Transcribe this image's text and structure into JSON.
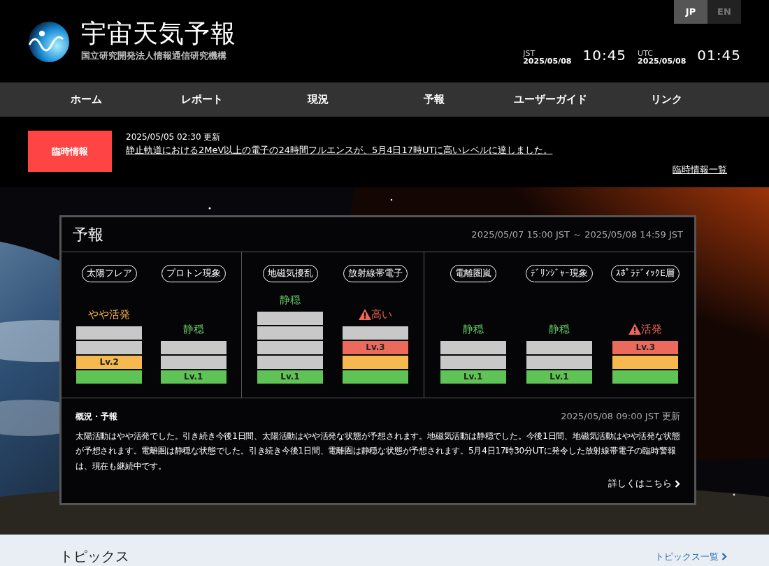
{
  "header": {
    "title": "宇宙天気予報",
    "subtitle": "国立研究開発法人情報通信研究機構",
    "languages": [
      {
        "label": "JP",
        "selected": true
      },
      {
        "label": "EN",
        "selected": false
      }
    ],
    "clocks": [
      {
        "zone": "JST",
        "date": "2025/05/08",
        "time": "10:45"
      },
      {
        "zone": "UTC",
        "date": "2025/05/08",
        "time": "01:45"
      }
    ]
  },
  "nav": [
    "ホーム",
    "レポート",
    "現況",
    "予報",
    "ユーザーガイド",
    "リンク"
  ],
  "alert": {
    "badge": "臨時情報",
    "updated": "2025/05/05 02:30 更新",
    "message": "静止軌道における2MeV以上の電子の24時間フルエンスが、5月4日17時UTに高いレベルに達しました。",
    "list_link": "臨時情報一覧"
  },
  "forecast": {
    "title": "予報",
    "period": "2025/05/07 15:00 JST ～ 2025/05/08 14:59 JST",
    "groups": [
      {
        "items": [
          {
            "name": "太陽フレア",
            "status": "やや活発",
            "kind": "active",
            "segments": [
              {
                "lit": false
              },
              {
                "lit": false
              },
              {
                "lit": true,
                "color": "#f5b94f",
                "label": "Lv.2"
              },
              {
                "lit": true,
                "color": "#5fc455"
              }
            ]
          },
          {
            "name": "プロトン現象",
            "status": "静穏",
            "kind": "quiet",
            "segments": [
              {
                "lit": false
              },
              {
                "lit": false
              },
              {
                "lit": true,
                "color": "#5fc455",
                "label": "Lv.1"
              }
            ]
          }
        ]
      },
      {
        "items": [
          {
            "name": "地磁気擾乱",
            "status": "静穏",
            "kind": "quiet",
            "segments": [
              {
                "lit": false
              },
              {
                "lit": false
              },
              {
                "lit": false
              },
              {
                "lit": false
              },
              {
                "lit": true,
                "color": "#5fc455",
                "label": "Lv.1"
              }
            ]
          },
          {
            "name": "放射線帯電子",
            "status": "高い",
            "kind": "alert",
            "segments": [
              {
                "lit": false
              },
              {
                "lit": true,
                "color": "#ec6a5c",
                "label": "Lv.3"
              },
              {
                "lit": true,
                "color": "#f5b94f"
              },
              {
                "lit": true,
                "color": "#5fc455"
              }
            ]
          }
        ]
      },
      {
        "items": [
          {
            "name": "電離圏嵐",
            "status": "静穏",
            "kind": "quiet",
            "segments": [
              {
                "lit": false
              },
              {
                "lit": false
              },
              {
                "lit": true,
                "color": "#5fc455",
                "label": "Lv.1"
              }
            ]
          },
          {
            "name": "ﾃﾞﾘﾝｼﾞｬｰ現象",
            "status": "静穏",
            "kind": "quiet",
            "segments": [
              {
                "lit": false
              },
              {
                "lit": false
              },
              {
                "lit": true,
                "color": "#5fc455",
                "label": "Lv.1"
              }
            ]
          },
          {
            "name": "ｽﾎﾟﾗﾃﾞｨｯｸE層",
            "status": "活発",
            "kind": "alert",
            "segments": [
              {
                "lit": true,
                "color": "#ec6a5c",
                "label": "Lv.3"
              },
              {
                "lit": true,
                "color": "#f5b94f"
              },
              {
                "lit": true,
                "color": "#5fc455"
              }
            ]
          }
        ]
      }
    ],
    "summary": {
      "heading": "概況・予報",
      "updated": "2025/05/08 09:00 JST 更新",
      "text": "太陽活動はやや活発でした。引き続き今後1日間、太陽活動はやや活発な状態が予想されます。地磁気活動は静穏でした。今後1日間、地磁気活動はやや活発な状態が予想されます。電離圏は静穏な状態でした。引き続き今後1日間、電離圏は静穏な状態が予想されます。5月4日17時30分UTに発令した放射線帯電子の臨時警報は、現在も継続中です。",
      "more_link": "詳しくはこちら"
    }
  },
  "topics": {
    "title": "トピックス",
    "list_link": "トピックス一覧"
  }
}
